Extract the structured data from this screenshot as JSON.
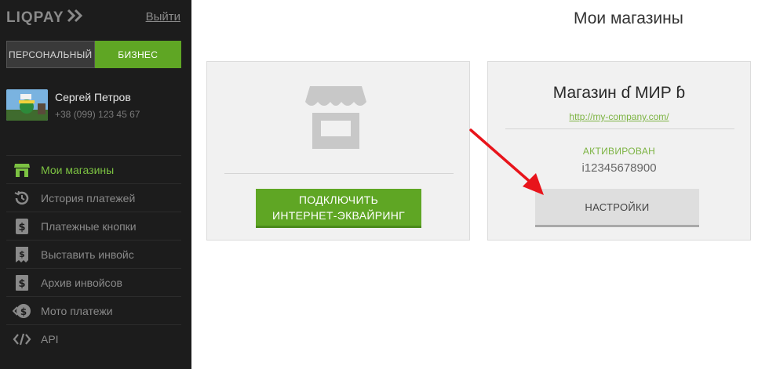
{
  "brand": {
    "logo_text": "LIQPAY",
    "logo_icon": "double-chevron-right-icon"
  },
  "header": {
    "logout_label": "Выйти"
  },
  "mode_switch": {
    "personal_label": "ПЕРСОНАЛЬНЫЙ",
    "business_label": "БИЗНЕС",
    "active": "business"
  },
  "profile": {
    "name": "Сергей Петров",
    "phone": "+38 (099) 123 45 67"
  },
  "sidebar": {
    "items": [
      {
        "label": "Мои магазины",
        "icon": "store-icon",
        "active": true
      },
      {
        "label": "История платежей",
        "icon": "history-icon",
        "active": false
      },
      {
        "label": "Платежные кнопки",
        "icon": "dollar-document-icon",
        "active": false
      },
      {
        "label": "Выставить инвойс",
        "icon": "invoice-icon",
        "active": false
      },
      {
        "label": "Архив инвойсов",
        "icon": "invoice-archive-icon",
        "active": false
      },
      {
        "label": "Мото платежи",
        "icon": "moto-payment-icon",
        "active": false
      },
      {
        "label": "API",
        "icon": "code-icon",
        "active": false
      }
    ]
  },
  "main": {
    "title": "Мои магазины",
    "connect_card": {
      "icon": "store-icon",
      "button_line1": "ПОДКЛЮЧИТЬ",
      "button_line2": "ИНТЕРНЕТ-ЭКВАЙРИНГ"
    },
    "shop_card": {
      "name": "Магазин ɗ МИР ɓ",
      "url": "http://my-company.com/",
      "status": "АКТИВИРОВАН",
      "id": "i12345678900",
      "settings_label": "НАСТРОЙКИ"
    }
  },
  "colors": {
    "sidebar_bg": "#1c1c1c",
    "accent_green": "#5fa624",
    "link_green": "#7cb342",
    "annotation_red": "#e8141b"
  }
}
